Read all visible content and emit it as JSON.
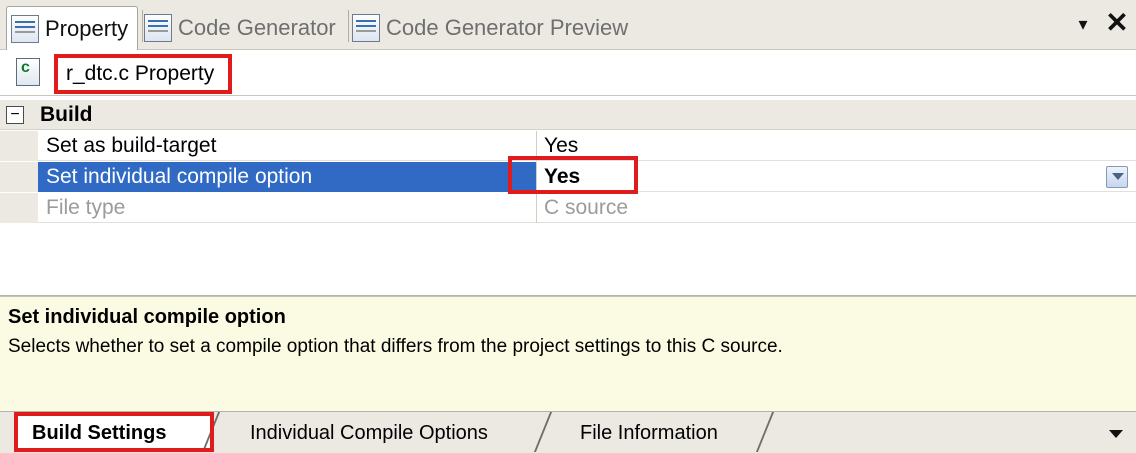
{
  "tabs": [
    {
      "label": "Property",
      "icon": "property-icon",
      "active": true
    },
    {
      "label": "Code Generator",
      "icon": "code-generator-icon",
      "active": false
    },
    {
      "label": "Code Generator Preview",
      "icon": "code-generator-preview-icon",
      "active": false
    }
  ],
  "window_controls": {
    "menu_glyph": "▾",
    "close_glyph": "✕"
  },
  "title": "r_dtc.c Property",
  "category": {
    "label": "Build",
    "toggle": "−"
  },
  "properties": [
    {
      "name": "Set as build-target",
      "value": "Yes",
      "state": "normal"
    },
    {
      "name": "Set individual compile option",
      "value": "Yes",
      "state": "selected"
    },
    {
      "name": "File type",
      "value": "C source",
      "state": "disabled"
    }
  ],
  "description": {
    "title": "Set individual compile option",
    "text": "Selects whether to set a compile option that differs from the project settings to this C source."
  },
  "bottom_tabs": [
    {
      "label": "Build Settings",
      "active": true
    },
    {
      "label": "Individual Compile Options",
      "active": false
    },
    {
      "label": "File Information",
      "active": false
    }
  ],
  "colors": {
    "selection": "#316ac5",
    "highlight": "#e01b1b",
    "description_bg": "#fbfae2",
    "panel_bg": "#ebe9e2"
  }
}
